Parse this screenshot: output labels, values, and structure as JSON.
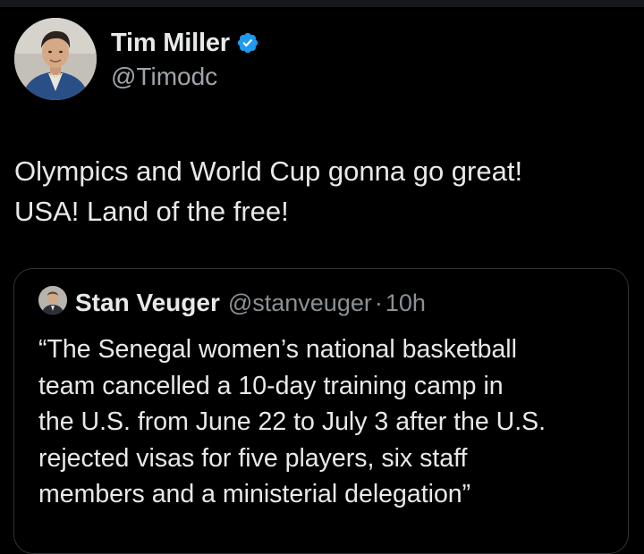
{
  "tweet": {
    "author": {
      "name": "Tim Miller",
      "handle": "@Timodc",
      "verified": true,
      "avatar_icon": "profile-photo"
    },
    "text_lines": [
      "Olympics and World Cup gonna go great!",
      "USA! Land of the free!"
    ],
    "quote": {
      "author": {
        "name": "Stan Veuger",
        "handle": "@stanveuger",
        "avatar_icon": "profile-photo"
      },
      "separator": "·",
      "time": "10h",
      "text_lines": [
        "“The Senegal women’s national basketball",
        "team cancelled a 10-day training camp in",
        "the U.S. from June 22 to July 3 after the U.S.",
        "rejected visas for five players, six staff",
        "members and a ministerial delegation”"
      ]
    }
  },
  "colors": {
    "background": "#000000",
    "text_primary": "#e7e9ea",
    "text_secondary": "#8b9095",
    "verified_blue": "#1d9bf0",
    "card_border": "#2f3336"
  }
}
